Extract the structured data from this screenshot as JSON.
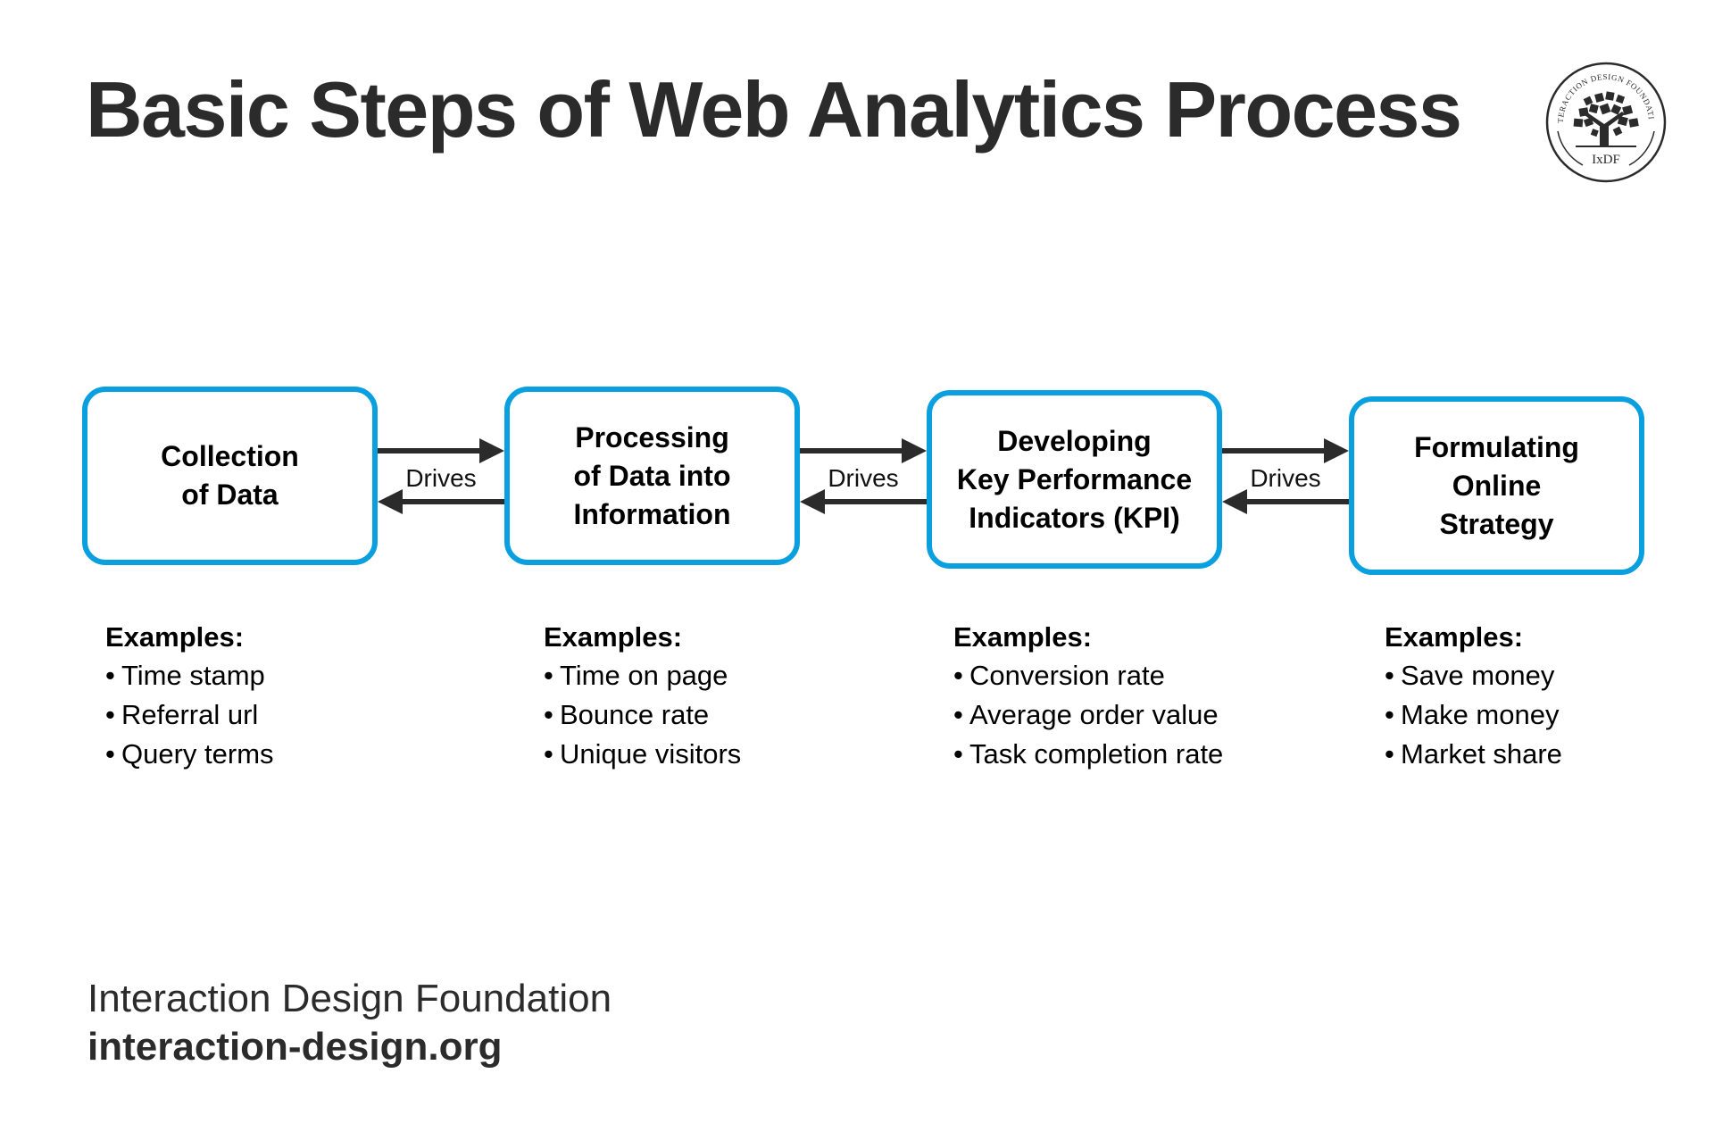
{
  "title": "Basic Steps of Web Analytics Process",
  "logo": {
    "ring_text": "INTERACTION DESIGN FOUNDATION",
    "monogram": "IxDF"
  },
  "colors": {
    "box_border": "#0a9fdf",
    "arrow": "#2b2b2b",
    "title_text": "#2b2b2b"
  },
  "steps": [
    {
      "label": "Collection\nof Data",
      "examples_heading": "Examples:",
      "examples": [
        "Time stamp",
        "Referral url",
        "Query terms"
      ]
    },
    {
      "label": "Processing\nof Data into\nInformation",
      "examples_heading": "Examples:",
      "examples": [
        "Time on page",
        "Bounce rate",
        "Unique visitors"
      ]
    },
    {
      "label": "Developing\nKey Performance\nIndicators (KPI)",
      "examples_heading": "Examples:",
      "examples": [
        "Conversion rate",
        "Average order value",
        "Task completion rate"
      ]
    },
    {
      "label": "Formulating\nOnline\nStrategy",
      "examples_heading": "Examples:",
      "examples": [
        "Save money",
        "Make money",
        "Market share"
      ]
    }
  ],
  "connectors": [
    {
      "label": "Drives"
    },
    {
      "label": "Drives"
    },
    {
      "label": "Drives"
    }
  ],
  "footer": {
    "organization": "Interaction Design Foundation",
    "url": "interaction-design.org"
  }
}
